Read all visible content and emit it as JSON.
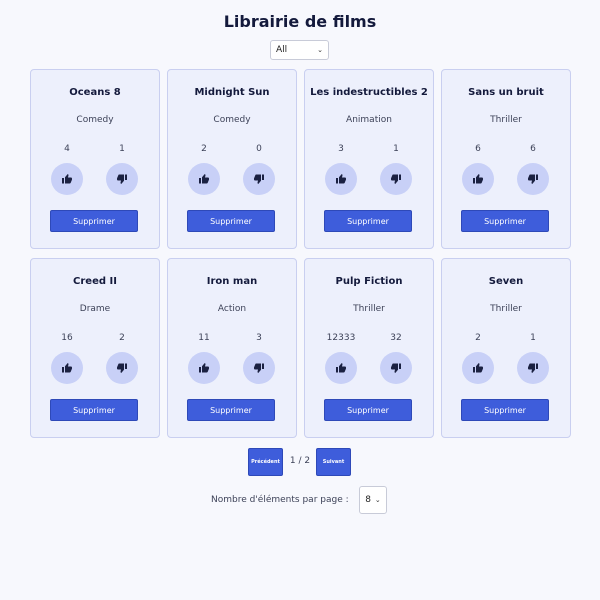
{
  "page": {
    "title": "Librairie de films"
  },
  "filter": {
    "selected": "All"
  },
  "movies": [
    {
      "title": "Oceans 8",
      "category": "Comedy",
      "likes": "4",
      "dislikes": "1",
      "delete_label": "Supprimer"
    },
    {
      "title": "Midnight Sun",
      "category": "Comedy",
      "likes": "2",
      "dislikes": "0",
      "delete_label": "Supprimer"
    },
    {
      "title": "Les indestructibles 2",
      "category": "Animation",
      "likes": "3",
      "dislikes": "1",
      "delete_label": "Supprimer"
    },
    {
      "title": "Sans un bruit",
      "category": "Thriller",
      "likes": "6",
      "dislikes": "6",
      "delete_label": "Supprimer"
    },
    {
      "title": "Creed II",
      "category": "Drame",
      "likes": "16",
      "dislikes": "2",
      "delete_label": "Supprimer"
    },
    {
      "title": "Iron man",
      "category": "Action",
      "likes": "11",
      "dislikes": "3",
      "delete_label": "Supprimer"
    },
    {
      "title": "Pulp Fiction",
      "category": "Thriller",
      "likes": "12333",
      "dislikes": "32",
      "delete_label": "Supprimer"
    },
    {
      "title": "Seven",
      "category": "Thriller",
      "likes": "2",
      "dislikes": "1",
      "delete_label": "Supprimer"
    }
  ],
  "pagination": {
    "prev_label": "Précédent",
    "next_label": "Suivant",
    "page_indicator": "1 / 2",
    "per_page_label": "Nombre d'éléments par page :",
    "per_page_value": "8"
  },
  "icons": {
    "like": "thumbs-up-icon",
    "dislike": "thumbs-down-icon",
    "dropdown": "chevron-down-icon"
  },
  "colors": {
    "accent": "#3e5ddb",
    "card_bg": "#edf0fc",
    "vote_bg": "#c8d0f7",
    "title": "#141a3c"
  }
}
